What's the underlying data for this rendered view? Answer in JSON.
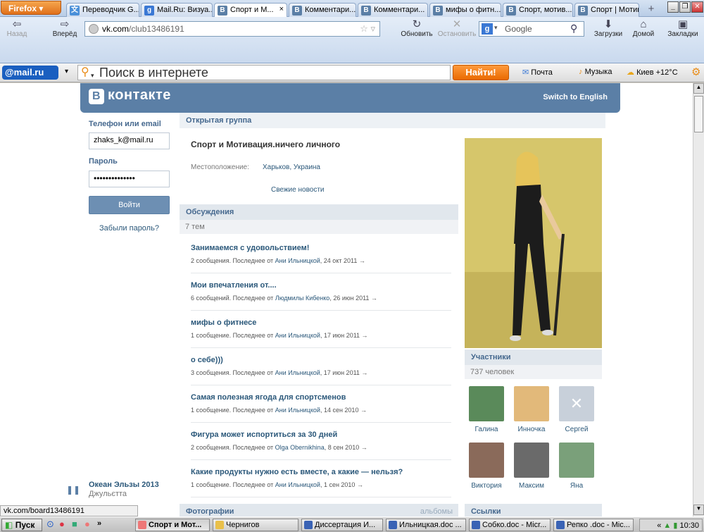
{
  "browser": {
    "menu_button": "Firefox",
    "tabs": [
      {
        "label": "Переводчик G...",
        "icon": "google-translate-icon",
        "color": "#4a90d9"
      },
      {
        "label": "Mail.Ru: Визуа...",
        "icon": "google-icon",
        "color": "#3a78d4"
      },
      {
        "label": "Спорт и М...",
        "icon": "vk-icon",
        "color": "#5b7fa6",
        "active": true
      },
      {
        "label": "Комментари...",
        "icon": "vk-icon",
        "color": "#5b7fa6"
      },
      {
        "label": "Комментари...",
        "icon": "vk-icon",
        "color": "#5b7fa6"
      },
      {
        "label": "мифы о фитн...",
        "icon": "vk-icon",
        "color": "#5b7fa6"
      },
      {
        "label": "Спорт, мотив...",
        "icon": "vk-icon",
        "color": "#5b7fa6"
      },
      {
        "label": "Спорт | Мотив...",
        "icon": "vk-icon",
        "color": "#5b7fa6"
      }
    ],
    "nav": {
      "back": "Назад",
      "forward": "Вперёд",
      "url_domain": "vk.com",
      "url_path": "/club13486191",
      "reload": "Обновить",
      "stop": "Остановить",
      "search_placeholder": "Google",
      "downloads": "Загрузки",
      "home": "Домой",
      "bookmarks": "Закладки"
    },
    "mailru": {
      "logo": "@mail.ru",
      "search_placeholder": "Поиск в интернете",
      "find_button": "Найти!",
      "mail": "Почта",
      "music": "Музыка",
      "weather": "Киев +12°C"
    },
    "status_url": "vk.com/board13486191"
  },
  "vk": {
    "logo": "контакте",
    "logo_letter": "В",
    "switch_lang": "Switch to English",
    "login": {
      "email_label": "Телефон или email",
      "email_value": "zhaks_k@mail.ru",
      "password_label": "Пароль",
      "password_value": "••••••••••••••",
      "login_button": "Войти",
      "forgot": "Забыли пароль?"
    },
    "music": {
      "title": "Океан Эльзы 2013",
      "artist": "Джульєтта"
    },
    "group": {
      "type": "Открытая группа",
      "name": "Спорт и Мотивация.ничего личного",
      "location_label": "Местоположение:",
      "location_value": "Харьков, Украина",
      "fresh_news": "Свежие новости"
    },
    "discussions": {
      "title": "Обсуждения",
      "count": "7 тем",
      "topics": [
        {
          "title": "Занимаемся с удовольствием!",
          "meta": "2 сообщения. Последнее от ",
          "author": "Ани Ильницкой",
          "date": ", 24 окт 2011  →"
        },
        {
          "title": "Мои впечатления от....",
          "meta": "6 сообщений. Последнее от ",
          "author": "Людмилы Кибенко",
          "date": ", 26 июн 2011  →"
        },
        {
          "title": "мифы о фитнесе",
          "meta": "1 сообщение. Последнее от ",
          "author": "Ани Ильницкой",
          "date": ", 17 июн 2011  →"
        },
        {
          "title": "о себе)))",
          "meta": "3 сообщения. Последнее от ",
          "author": "Ани Ильницкой",
          "date": ", 17 июн 2011  →"
        },
        {
          "title": "Самая полезная ягода для спортсменов",
          "meta": "1 сообщение. Последнее от ",
          "author": "Ани Ильницкой",
          "date": ", 14 сен 2010  →"
        },
        {
          "title": "Фигура может испортиться за 30 дней",
          "meta": "2 сообщения. Последнее от ",
          "author": "Olga Obernikhina",
          "date": ", 8 сен 2010  →"
        },
        {
          "title": "Какие продукты нужно есть вместе, а какие — нельзя?",
          "meta": "1 сообщение. Последнее от ",
          "author": "Ани Ильницкой",
          "date": ", 1 сен 2010  →"
        }
      ]
    },
    "photos": {
      "title": "Фотографии",
      "albums": "альбомы"
    },
    "members": {
      "title": "Участники",
      "count": "737 человек",
      "list": [
        "Галина",
        "Инночка",
        "Сергей",
        "Виктория",
        "Максим",
        "Яна"
      ]
    },
    "links": {
      "title": "Ссылки"
    }
  },
  "taskbar": {
    "start": "Пуск",
    "items": [
      {
        "label": "Спорт и Мот...",
        "active": true
      },
      {
        "label": "Чернигов"
      },
      {
        "label": "Диссертация И..."
      },
      {
        "label": "Ильницкая.doc ..."
      },
      {
        "label": "Собко.doc - Micr..."
      },
      {
        "label": "Репко .doc - Mic..."
      }
    ],
    "time": "10:30"
  }
}
